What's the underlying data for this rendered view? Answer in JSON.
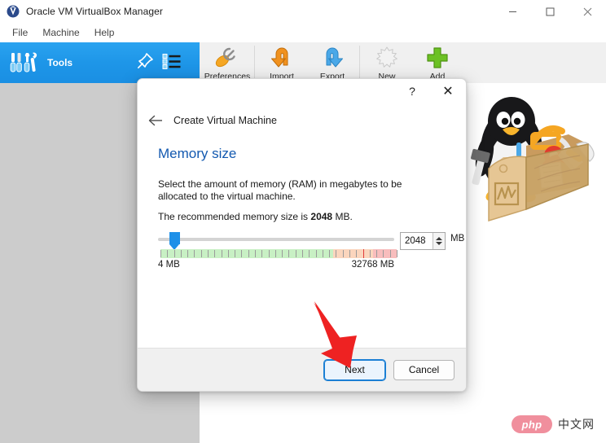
{
  "window": {
    "title": "Oracle VM VirtualBox Manager",
    "icon": "virtualbox-logo-icon",
    "controls": {
      "minimize": "minimize-icon",
      "maximize": "maximize-icon",
      "close": "close-icon"
    }
  },
  "menubar": {
    "items": [
      {
        "label": "File"
      },
      {
        "label": "Machine"
      },
      {
        "label": "Help"
      }
    ]
  },
  "tools_chip": {
    "label": "Tools",
    "icon": "tools-icon",
    "actions": [
      {
        "name": "pin-icon"
      },
      {
        "name": "list-view-icon"
      }
    ]
  },
  "toolbar": {
    "buttons": [
      {
        "label": "Preferences",
        "icon": "preferences-icon"
      },
      {
        "label": "Import",
        "icon": "import-icon"
      },
      {
        "label": "Export",
        "icon": "export-icon"
      },
      {
        "label": "New",
        "icon": "new-icon"
      },
      {
        "label": "Add",
        "icon": "add-icon"
      }
    ]
  },
  "banner": {
    "art": "tux-penguin-toolbox-illustration"
  },
  "watermark": {
    "brand": "php",
    "suffix": "中文网"
  },
  "dialog": {
    "titlebar": {
      "help": "?",
      "close": "✕"
    },
    "back_icon": "back-arrow-icon",
    "wizard_title": "Create Virtual Machine",
    "heading": "Memory size",
    "paragraph": "Select the amount of memory (RAM) in megabytes to be allocated to the virtual machine.",
    "recommend_prefix": "The recommended memory size is ",
    "recommend_value": "2048",
    "recommend_suffix": " MB.",
    "slider": {
      "value": 2048,
      "min_label": "4 MB",
      "max_label": "32768 MB",
      "min": 4,
      "max": 32768,
      "handle_percent": 7,
      "segments": [
        {
          "name": "green-safe",
          "percent": 73,
          "color": "#c8f0c4"
        },
        {
          "name": "orange-warning",
          "percent": 17,
          "color": "#fbd5bd"
        },
        {
          "name": "red-danger",
          "percent": 10,
          "color": "#f8bdbd"
        }
      ]
    },
    "spinbox": {
      "value": "2048",
      "unit": "MB"
    },
    "buttons": {
      "next": "Next",
      "cancel": "Cancel"
    }
  },
  "annotation": {
    "arrow": "red-arrow-pointing-to-next-button",
    "color": "#ee2222"
  }
}
